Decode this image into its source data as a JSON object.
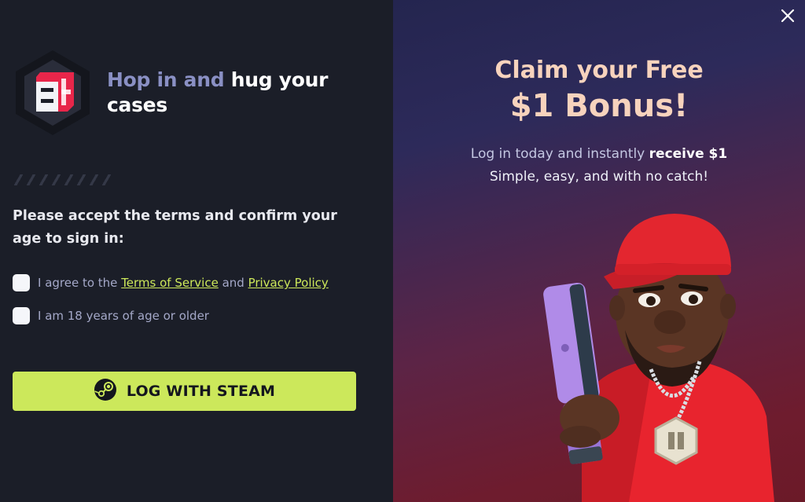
{
  "left": {
    "headline": {
      "part1": "Hop in and ",
      "part2": "hug your cases"
    },
    "prompt": "Please accept the terms and confirm your age to sign in:",
    "terms": {
      "prefix": "I agree to the ",
      "tos_link": "Terms of Service",
      "and": " and ",
      "privacy_link": "Privacy Policy"
    },
    "age": {
      "label": "I am 18 years of age or older"
    },
    "login_button": {
      "label": "LOG WITH STEAM",
      "icon": "steam-icon"
    }
  },
  "right": {
    "title_line1": "Claim your Free",
    "title_line2": "$1 Bonus!",
    "sub_line1_prefix": "Log in today and instantly ",
    "sub_line1_bold": "receive $1",
    "sub_line2": "Simple, easy, and with no catch!",
    "close_icon": "close-icon"
  },
  "colors": {
    "accent": "#cce85b",
    "left_bg": "#1b1e28",
    "title_peach": "#f7d3bd",
    "muted_text": "#8a90c4"
  }
}
